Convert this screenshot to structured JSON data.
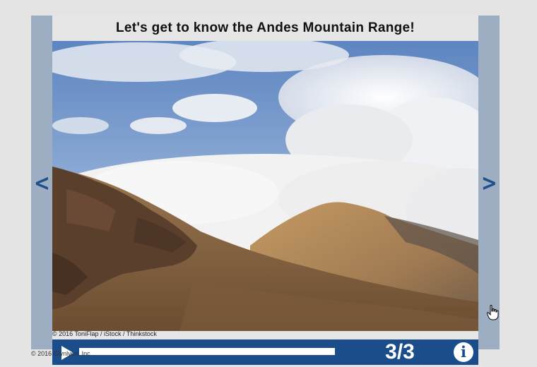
{
  "slide": {
    "title": "Let's get to know the Andes Mountain Range!",
    "photo_alt": "",
    "photo_credit": "© 2016 ToniFlap / iStock / Thinkstock"
  },
  "navigation": {
    "prev_glyph": "<",
    "next_glyph": ">",
    "prev_icon": "chevron-left-icon",
    "next_icon": "chevron-right-icon"
  },
  "player": {
    "play_icon": "play-icon",
    "progress": 1.0,
    "counter": "3/3",
    "info_icon": "info-icon",
    "info_glyph": "i"
  },
  "footer": {
    "copyright": "© 2016 Glynlyon, Inc."
  },
  "colors": {
    "accent_blue": "#1b4d8a",
    "rail_blue": "#9eaec2",
    "page_bg": "#e4e4e4"
  }
}
